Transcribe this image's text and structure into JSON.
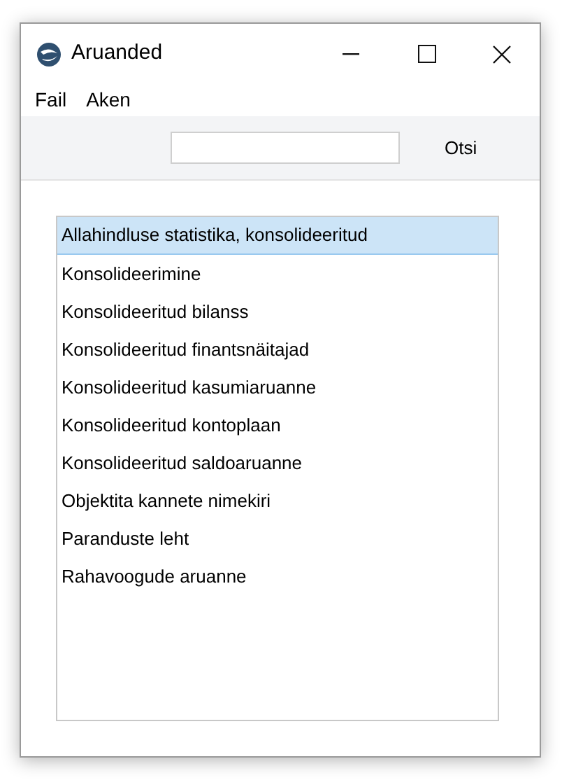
{
  "window": {
    "title": "Aruanded"
  },
  "menu": [
    "Fail",
    "Aken"
  ],
  "search": {
    "button": "Otsi"
  },
  "list": [
    {
      "label": "Allahindluse statistika, konsolideeritud",
      "selected": true
    },
    {
      "label": "Konsolideerimine",
      "selected": false
    },
    {
      "label": "Konsolideeritud bilanss",
      "selected": false
    },
    {
      "label": "Konsolideeritud finantsnäitajad",
      "selected": false
    },
    {
      "label": "Konsolideeritud kasumiaruanne",
      "selected": false
    },
    {
      "label": "Konsolideeritud kontoplaan",
      "selected": false
    },
    {
      "label": "Konsolideeritud saldoaruanne",
      "selected": false
    },
    {
      "label": "Objektita kannete nimekiri",
      "selected": false
    },
    {
      "label": "Paranduste leht",
      "selected": false
    },
    {
      "label": "Rahavoogude aruanne",
      "selected": false
    }
  ]
}
